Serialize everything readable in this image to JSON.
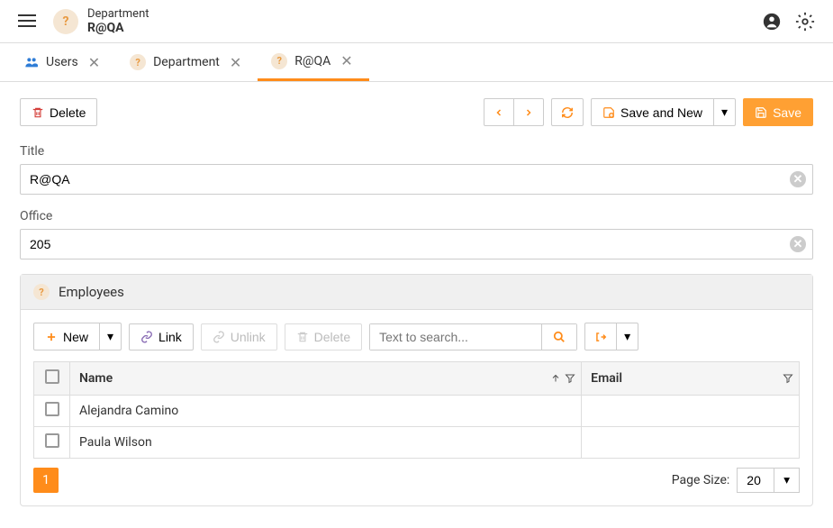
{
  "header": {
    "breadcrumb": "Department",
    "title": "R@QA"
  },
  "tabs": [
    {
      "label": "Users",
      "icon": "users",
      "active": false
    },
    {
      "label": "Department",
      "icon": "q",
      "active": false
    },
    {
      "label": "R@QA",
      "icon": "q",
      "active": true
    }
  ],
  "toolbar": {
    "delete_label": "Delete",
    "save_and_new_label": "Save and New",
    "save_label": "Save"
  },
  "form": {
    "title_label": "Title",
    "title_value": "R@QA",
    "office_label": "Office",
    "office_value": "205"
  },
  "employees": {
    "panel_title": "Employees",
    "new_label": "New",
    "link_label": "Link",
    "unlink_label": "Unlink",
    "delete_label": "Delete",
    "search_placeholder": "Text to search...",
    "columns": {
      "name": "Name",
      "email": "Email"
    },
    "rows": [
      {
        "name": "Alejandra Camino",
        "email": ""
      },
      {
        "name": "Paula Wilson",
        "email": ""
      }
    ],
    "current_page": "1",
    "page_size_label": "Page Size:",
    "page_size_value": "20"
  }
}
